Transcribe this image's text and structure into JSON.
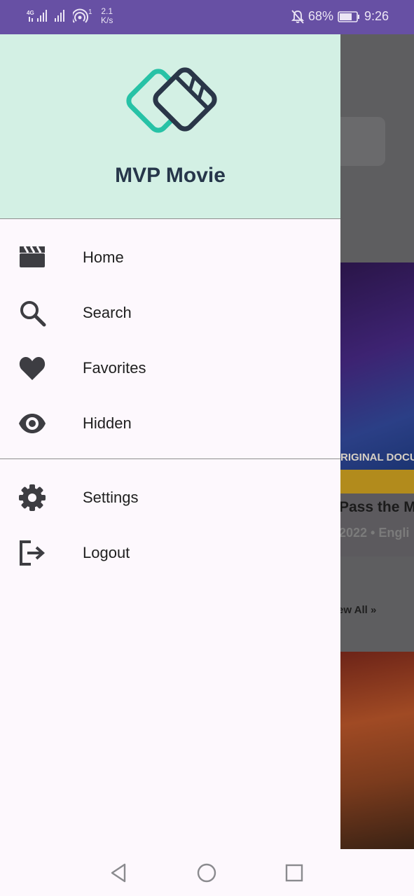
{
  "status_bar": {
    "network_4g": "4G",
    "sim_number": "1",
    "speed_value": "2.1",
    "speed_unit": "K/s",
    "battery": "68%",
    "time": "9:26"
  },
  "drawer": {
    "app_name": "MVP Movie",
    "primary_items": [
      {
        "label": "Home",
        "icon": "clapperboard-icon"
      },
      {
        "label": "Search",
        "icon": "search-icon"
      },
      {
        "label": "Favorites",
        "icon": "heart-icon"
      },
      {
        "label": "Hidden",
        "icon": "eye-icon"
      }
    ],
    "secondary_items": [
      {
        "label": "Settings",
        "icon": "gear-icon"
      },
      {
        "label": "Logout",
        "icon": "logout-icon"
      }
    ]
  },
  "background": {
    "poster_text": "RIGINAL DOCUM",
    "movie_title": "Pass the M",
    "movie_meta": "2022 • Engli",
    "view_all": "ew All"
  },
  "colors": {
    "status_bar": "#6750a4",
    "header": "#d3f0e4",
    "drawer": "#fdf8fd",
    "logo_teal": "#27c2a6",
    "logo_dark": "#2a3648",
    "icon": "#3d3d42"
  },
  "nav_bar": {
    "buttons": [
      "back-icon",
      "home-circle-icon",
      "recents-square-icon"
    ]
  }
}
